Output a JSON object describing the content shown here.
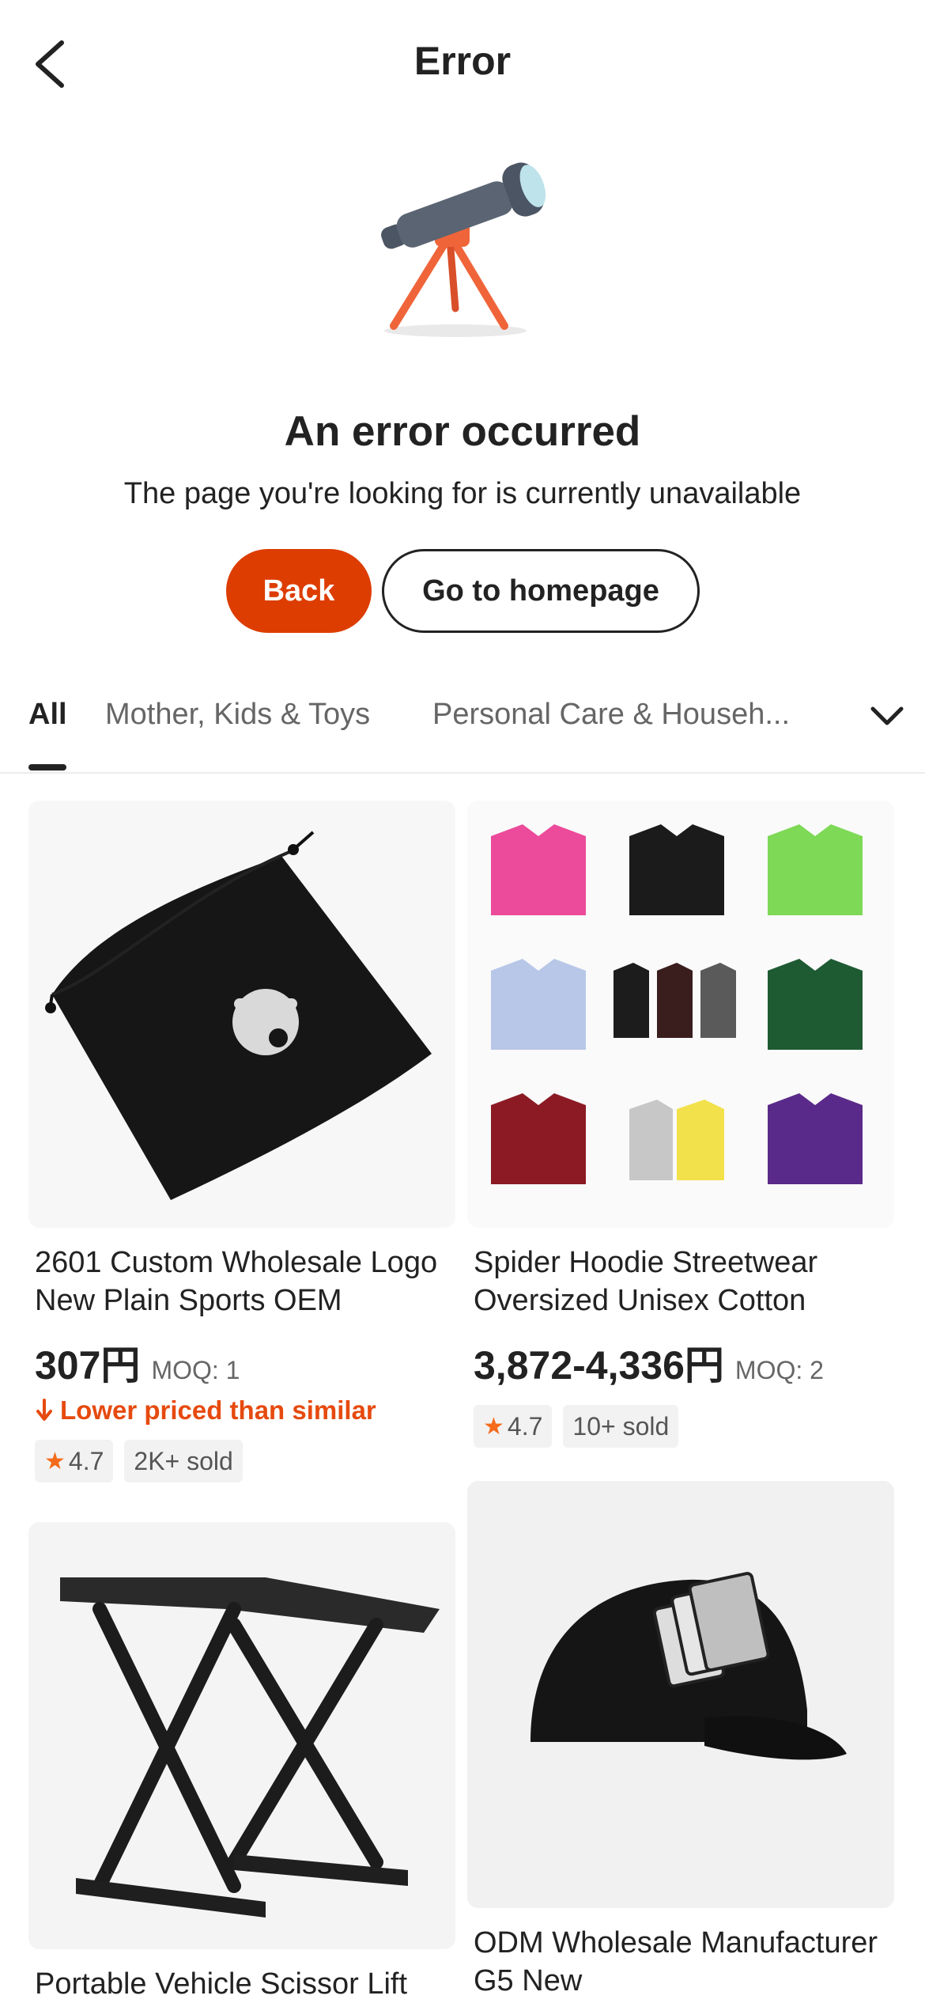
{
  "header": {
    "title": "Error"
  },
  "error": {
    "title": "An error occurred",
    "message": "The page you're looking for is currently unavailable",
    "back_label": "Back",
    "home_label": "Go to homepage"
  },
  "tabs": [
    {
      "label": "All",
      "active": true
    },
    {
      "label": "Mother, Kids & Toys",
      "active": false
    },
    {
      "label": "Personal Care & Househ...",
      "active": false
    }
  ],
  "products": [
    {
      "title": "2601 Custom Wholesale Logo New Plain Sports OEM",
      "price": "307円",
      "moq": "MOQ: 1",
      "promo": "Lower priced than similar",
      "rating": "4.7",
      "sold": "2K+ sold",
      "image": "black-drawstring-bag"
    },
    {
      "title": "Spider Hoodie Streetwear Oversized Unisex Cotton",
      "price": "3,872-4,336円",
      "moq": "MOQ: 2",
      "rating": "4.7",
      "sold": "10+ sold",
      "image": "hoodies-grid"
    },
    {
      "title": "Portable Vehicle Scissor Lift",
      "image": "scissor-lift"
    },
    {
      "title": "ODM Wholesale Manufacturer G5 New",
      "image": "black-cap"
    }
  ],
  "colors": {
    "accent": "#dd3d00",
    "promo": "#e64a0f",
    "star": "#f56a1b",
    "text": "#222222",
    "muted": "#666666"
  }
}
